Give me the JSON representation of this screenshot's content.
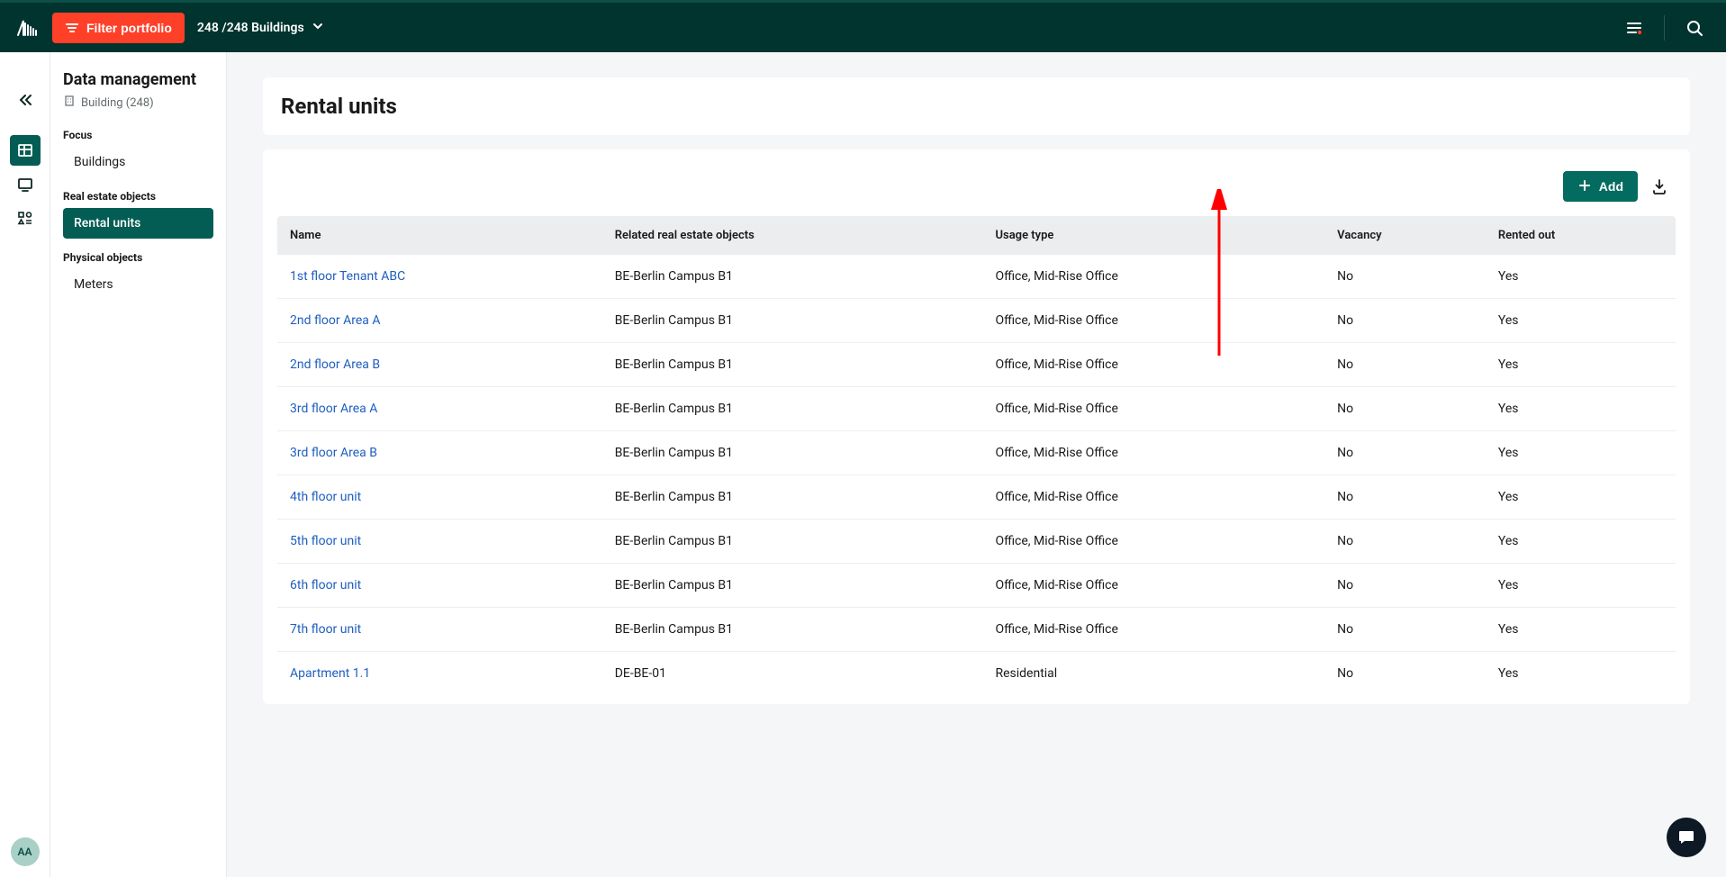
{
  "topbar": {
    "filter_label": "Filter portfolio",
    "buildings_count_label": "248 /248 Buildings"
  },
  "rail": {
    "avatar_initials": "AA"
  },
  "sidebar": {
    "title": "Data management",
    "subtitle": "Building (248)",
    "groups": [
      {
        "label": "Focus",
        "items": [
          {
            "label": "Buildings",
            "active": false
          }
        ]
      },
      {
        "label": "Real estate objects",
        "items": [
          {
            "label": "Rental units",
            "active": true
          }
        ]
      },
      {
        "label": "Physical objects",
        "items": [
          {
            "label": "Meters",
            "active": false
          }
        ]
      }
    ]
  },
  "page": {
    "title": "Rental units",
    "add_label": "Add"
  },
  "table": {
    "headers": {
      "name": "Name",
      "related": "Related real estate objects",
      "usage": "Usage type",
      "vacancy": "Vacancy",
      "rented": "Rented out"
    },
    "rows": [
      {
        "name": "1st floor Tenant ABC",
        "related": "BE-Berlin Campus B1",
        "usage": "Office, Mid-Rise Office",
        "vacancy": "No",
        "rented": "Yes"
      },
      {
        "name": "2nd floor Area A",
        "related": "BE-Berlin Campus B1",
        "usage": "Office, Mid-Rise Office",
        "vacancy": "No",
        "rented": "Yes"
      },
      {
        "name": "2nd floor Area B",
        "related": "BE-Berlin Campus B1",
        "usage": "Office, Mid-Rise Office",
        "vacancy": "No",
        "rented": "Yes"
      },
      {
        "name": "3rd floor Area A",
        "related": "BE-Berlin Campus B1",
        "usage": "Office, Mid-Rise Office",
        "vacancy": "No",
        "rented": "Yes"
      },
      {
        "name": "3rd floor Area B",
        "related": "BE-Berlin Campus B1",
        "usage": "Office, Mid-Rise Office",
        "vacancy": "No",
        "rented": "Yes"
      },
      {
        "name": "4th floor unit",
        "related": "BE-Berlin Campus B1",
        "usage": "Office, Mid-Rise Office",
        "vacancy": "No",
        "rented": "Yes"
      },
      {
        "name": "5th floor unit",
        "related": "BE-Berlin Campus B1",
        "usage": "Office, Mid-Rise Office",
        "vacancy": "No",
        "rented": "Yes"
      },
      {
        "name": "6th floor unit",
        "related": "BE-Berlin Campus B1",
        "usage": "Office, Mid-Rise Office",
        "vacancy": "No",
        "rented": "Yes"
      },
      {
        "name": "7th floor unit",
        "related": "BE-Berlin Campus B1",
        "usage": "Office, Mid-Rise Office",
        "vacancy": "No",
        "rented": "Yes"
      },
      {
        "name": "Apartment 1.1",
        "related": "DE-BE-01",
        "usage": "Residential",
        "vacancy": "No",
        "rented": "Yes"
      }
    ]
  }
}
